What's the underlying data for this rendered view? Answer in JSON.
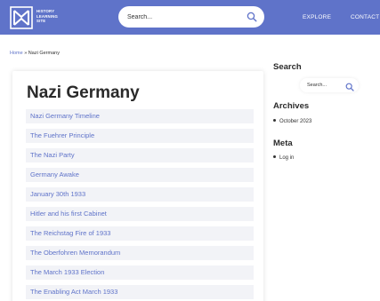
{
  "header": {
    "logo_lines": [
      "HISTORY",
      "LEARNING",
      "SITE"
    ],
    "search": {
      "placeholder": "Search..."
    },
    "nav": [
      {
        "label": "EXPLORE"
      },
      {
        "label": "CONTACT"
      }
    ]
  },
  "breadcrumb": {
    "home": "Home",
    "separator": "»",
    "current": "Nazi Germany"
  },
  "main": {
    "title": "Nazi Germany",
    "links": [
      "Nazi Germany Timeline",
      "The Fuehrer Principle",
      "The Nazi Party",
      "Germany Awake",
      "January 30th 1933",
      "Hitler and his first Cabinet",
      "The Reichstag Fire of 1933",
      "The Oberfohren Memorandum",
      "The March 1933 Election",
      "The Enabling Act March 1933"
    ]
  },
  "sidebar": {
    "search_heading": "Search",
    "search_placeholder": "Search...",
    "archives_heading": "Archives",
    "archives": [
      "October 2023"
    ],
    "meta_heading": "Meta",
    "meta": [
      "Log in"
    ]
  },
  "colors": {
    "brand": "#5f73c9",
    "link_bg": "#f2f3f7",
    "text": "#2a2a2a"
  }
}
